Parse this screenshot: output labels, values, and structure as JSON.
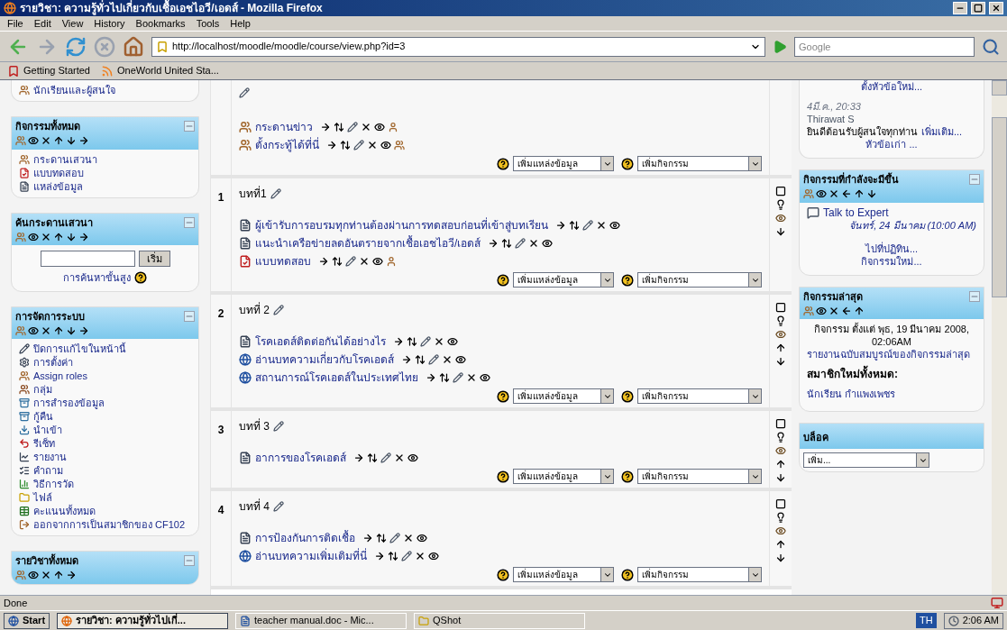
{
  "window": {
    "title": "รายวิชา: ความรู้ทั่วไปเกี่ยวกับเชื้อเอชไอวี/เอดส์ - Mozilla Firefox"
  },
  "menu": [
    "File",
    "Edit",
    "View",
    "History",
    "Bookmarks",
    "Tools",
    "Help"
  ],
  "toolbar": {
    "url": "http://localhost/moodle/moodle/course/view.php?id=3",
    "search_placeholder": "Google"
  },
  "bookmarks": [
    "Getting Started",
    "OneWorld United Sta..."
  ],
  "left_blocks": [
    {
      "items": [
        {
          "kind": "roles",
          "label": "นักเรียนและผู้สนใจ"
        }
      ]
    },
    {
      "title": "กิจกรรมทั้งหมด",
      "movable_up": true,
      "movable_down": true,
      "items": [
        {
          "kind": "forum",
          "label": "กระดานเสวนา"
        },
        {
          "kind": "quiz",
          "label": "แบบทดสอบ"
        },
        {
          "kind": "resource",
          "label": "แหล่งข้อมูล"
        }
      ]
    },
    {
      "title": "ค้นกระดานเสวนา",
      "movable_up": true,
      "movable_down": true,
      "search": {
        "button": "เริ่ม",
        "advanced": "การค้นหาขั้นสูง"
      }
    },
    {
      "title": "การจัดการระบบ",
      "movable_up": true,
      "movable_down": true,
      "items": [
        {
          "kind": "edit",
          "label": "ปิดการแก้ไขในหน้านี้"
        },
        {
          "kind": "settings",
          "label": "การตั้งค่า"
        },
        {
          "kind": "roles",
          "label": "Assign roles"
        },
        {
          "kind": "groups",
          "label": "กลุ่ม"
        },
        {
          "kind": "backup",
          "label": "การสำรองข้อมูล"
        },
        {
          "kind": "restore",
          "label": "กู้คืน"
        },
        {
          "kind": "import",
          "label": "นำเข้า"
        },
        {
          "kind": "reset",
          "label": "รีเซ็ท"
        },
        {
          "kind": "reports",
          "label": "รายงาน"
        },
        {
          "kind": "questions",
          "label": "คำถาม"
        },
        {
          "kind": "scales",
          "label": "วิธีการวัด"
        },
        {
          "kind": "files",
          "label": "ไฟล์"
        },
        {
          "kind": "grades",
          "label": "คะแนนทั้งหมด"
        },
        {
          "kind": "unenrol",
          "label": "ออกจากการเป็นสมาชิกของ CF102"
        }
      ]
    },
    {
      "title": "รายวิชาทั้งหมด",
      "movable_up": true,
      "movable_down": false
    }
  ],
  "sections": [
    {
      "kind": "general",
      "items": [
        {
          "kind": "forum",
          "label": "กระดานข่าว",
          "groups_visible": false
        },
        {
          "kind": "forum",
          "label": "ตั้งกระทู้ได้ที่นี่",
          "groups_visible": true
        }
      ],
      "add_resource": "เพิ่มแหล่งข้อมูล",
      "add_activity": "เพิ่มกิจกรรม"
    },
    {
      "kind": "topic",
      "number": "1",
      "title": "บทที่1",
      "movable_up": false,
      "movable_down": true,
      "items": [
        {
          "kind": "resource",
          "label": "ผู้เข้ารับการอบรมทุกท่านต้องผ่านการทดสอบก่อนที่เข้าสู่บทเรียน"
        },
        {
          "kind": "resource",
          "label": "แนะนำเครือข่ายลดอันตรายจากเชื้อเอชไอวี/เอดส์"
        },
        {
          "kind": "quiz",
          "label": "แบบทดสอบ",
          "groups_visible": false
        }
      ],
      "add_resource": "เพิ่มแหล่งข้อมูล",
      "add_activity": "เพิ่มกิจกรรม"
    },
    {
      "kind": "topic",
      "number": "2",
      "title": "บทที่ 2",
      "movable_up": true,
      "movable_down": true,
      "items": [
        {
          "kind": "resource",
          "label": "โรคเอดส์ติดต่อกันได้อย่างไร"
        },
        {
          "kind": "link",
          "label": "อ่านบทความเกี่ยวกับโรคเอดส์"
        },
        {
          "kind": "link",
          "label": "สถานการณ์โรคเอดส์ในประเทศไทย"
        }
      ],
      "add_resource": "เพิ่มแหล่งข้อมูล",
      "add_activity": "เพิ่มกิจกรรม"
    },
    {
      "kind": "topic",
      "number": "3",
      "title": "บทที่ 3",
      "movable_up": true,
      "movable_down": true,
      "items": [
        {
          "kind": "resource",
          "label": "อาการของโรคเอดส์"
        }
      ],
      "add_resource": "เพิ่มแหล่งข้อมูล",
      "add_activity": "เพิ่มกิจกรรม"
    },
    {
      "kind": "topic",
      "number": "4",
      "title": "บทที่ 4",
      "movable_up": true,
      "movable_down": true,
      "items": [
        {
          "kind": "resource",
          "label": "การป้องกันการติดเชื้อ"
        },
        {
          "kind": "link",
          "label": "อ่านบทความเพิ่มเติมที่นี่"
        }
      ],
      "add_resource": "เพิ่มแหล่งข้อมูล",
      "add_activity": "เพิ่มกิจกรรม"
    }
  ],
  "news": {
    "new_topic": "ตั้งหัวข้อใหม่...",
    "date": "4มี.ค., 20:33",
    "author": "Thirawat S",
    "text": "ยินดีต้อนรับผู้สนใจทุกท่าน",
    "more": "เพิ่มเติม...",
    "older": "หัวข้อเก่า ..."
  },
  "upcoming": {
    "title": "กิจกรรมที่กำลังจะมีขึ้น",
    "movable_up": true,
    "movable_down": true,
    "event": "Talk to Expert",
    "event_date": "จันทร์, 24 มีนาคม (10:00 AM)",
    "calendar": "ไปที่ปฏิทิน...",
    "new_event": "กิจกรรมใหม่..."
  },
  "recent": {
    "title": "กิจกรรมล่าสุด",
    "movable_up": true,
    "movable_down": false,
    "since": "กิจกรรม ตั้งแต่ พุธ, 19 มีนาคม 2008, 02:06AM",
    "report": "รายงานฉบับสมบูรณ์ของกิจกรรมล่าสุด",
    "heading": "สมาชิกใหม่ทั้งหมด:",
    "member": "นักเรียน กำแพงเพชร"
  },
  "blocks": {
    "title": "บล็อค",
    "add": "เพิ่ม..."
  },
  "status_bar": "Done",
  "taskbar": {
    "start": "Start",
    "tasks": [
      {
        "kind": "browser",
        "label": "รายวิชา: ความรู้ทั่วไปเกี่...",
        "selected": true
      },
      {
        "kind": "document",
        "label": "teacher manual.doc - Mic...",
        "selected": false
      },
      {
        "kind": "folder",
        "label": "QShot",
        "selected": false
      }
    ],
    "language": "TH",
    "clock": "2:06 AM"
  }
}
